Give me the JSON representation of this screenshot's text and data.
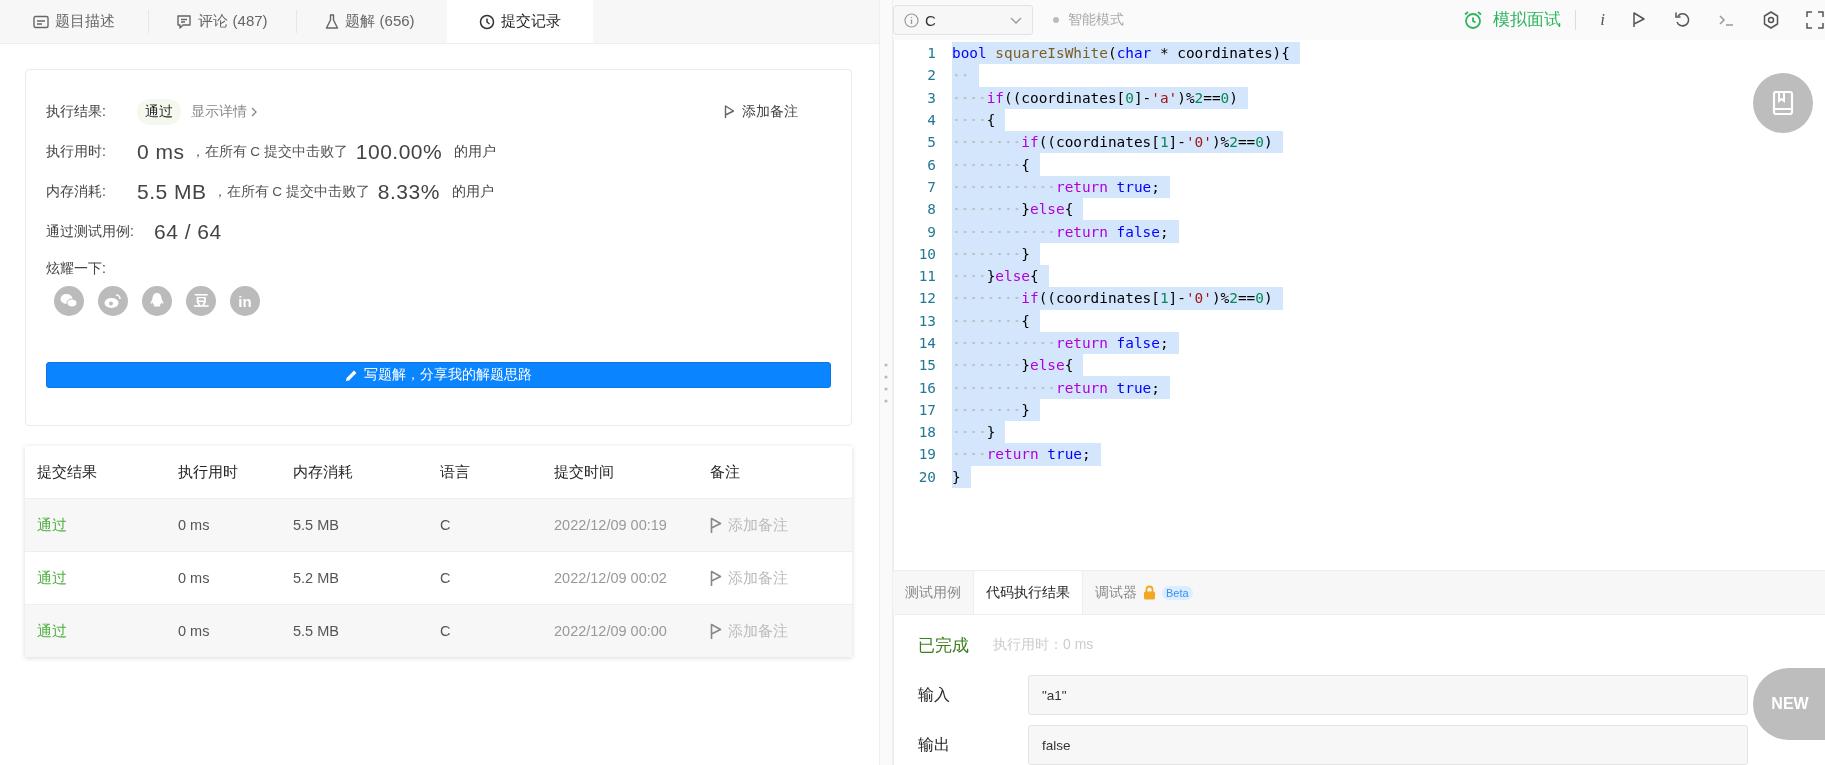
{
  "tabs": [
    {
      "label": "题目描述",
      "selected": false
    },
    {
      "label": "评论 (487)",
      "selected": false
    },
    {
      "label": "题解 (656)",
      "selected": false
    },
    {
      "label": "提交记录",
      "selected": true
    }
  ],
  "result_card": {
    "result_label": "执行结果:",
    "status": "通过",
    "details_link": "显示详情",
    "add_note": "添加备注",
    "stats": [
      {
        "label": "执行用时:",
        "value": "0 ms",
        "middle": "，在所有 C 提交中击败了",
        "percent": "100.00%",
        "suffix": "的用户"
      },
      {
        "label": "内存消耗:",
        "value": "5.5 MB",
        "middle": "，在所有 C 提交中击败了",
        "percent": "8.33%",
        "suffix": "的用户"
      }
    ],
    "tests_label": "通过测试用例:",
    "tests_value": "64 / 64",
    "share_label": "炫耀一下:",
    "share_icons": [
      {
        "kind": "wechat"
      },
      {
        "kind": "weibo"
      },
      {
        "kind": "qq"
      },
      {
        "kind": "douban",
        "text": "豆"
      },
      {
        "kind": "linkedin",
        "text": "in"
      }
    ],
    "write_button": "写题解，分享我的解题思路"
  },
  "submissions": {
    "columns": [
      "提交结果",
      "执行用时",
      "内存消耗",
      "语言",
      "提交时间",
      "备注"
    ],
    "rows": [
      {
        "status": "通过",
        "time": "0 ms",
        "memory": "5.5 MB",
        "language": "C",
        "submitted": "2022/12/09 00:19",
        "note": "添加备注"
      },
      {
        "status": "通过",
        "time": "0 ms",
        "memory": "5.2 MB",
        "language": "C",
        "submitted": "2022/12/09 00:02",
        "note": "添加备注"
      },
      {
        "status": "通过",
        "time": "0 ms",
        "memory": "5.5 MB",
        "language": "C",
        "submitted": "2022/12/09 00:00",
        "note": "添加备注"
      }
    ]
  },
  "editor": {
    "language": "C",
    "mode": "智能模式",
    "interview_button": "模拟面试",
    "info_button": "i",
    "lines": [
      {
        "number": "1",
        "selected": true,
        "tokens": [
          {
            "kind": "type",
            "text": "bool"
          },
          {
            "kind": "func",
            "text": " squareIsWhite"
          },
          {
            "kind": "plain",
            "text": "("
          },
          {
            "kind": "type",
            "text": "char"
          },
          {
            "kind": "plain",
            "text": " * coordinates){"
          }
        ]
      },
      {
        "number": "2",
        "selected": true
      },
      {
        "number": "3",
        "selected": true,
        "tokens": [
          {
            "kind": "control",
            "text": "    if"
          },
          {
            "kind": "plain",
            "text": "((coordinates["
          },
          {
            "kind": "number",
            "text": "0"
          },
          {
            "kind": "plain",
            "text": "]-"
          },
          {
            "kind": "string",
            "text": "'a'"
          },
          {
            "kind": "plain",
            "text": ")%"
          },
          {
            "kind": "number",
            "text": "2"
          },
          {
            "kind": "plain",
            "text": "=="
          },
          {
            "kind": "number",
            "text": "0"
          },
          {
            "kind": "plain",
            "text": ")"
          }
        ]
      },
      {
        "number": "4",
        "selected": true,
        "tokens": [
          {
            "kind": "plain",
            "text": "    {"
          }
        ]
      },
      {
        "number": "5",
        "selected": true,
        "tokens": [
          {
            "kind": "control",
            "text": "        if"
          },
          {
            "kind": "plain",
            "text": "((coordinates["
          },
          {
            "kind": "number",
            "text": "1"
          },
          {
            "kind": "plain",
            "text": "]-"
          },
          {
            "kind": "string",
            "text": "'0'"
          },
          {
            "kind": "plain",
            "text": ")%"
          },
          {
            "kind": "number",
            "text": "2"
          },
          {
            "kind": "plain",
            "text": "=="
          },
          {
            "kind": "number",
            "text": "0"
          },
          {
            "kind": "plain",
            "text": ")"
          }
        ]
      },
      {
        "number": "6",
        "selected": true,
        "tokens": [
          {
            "kind": "plain",
            "text": "        {"
          }
        ]
      },
      {
        "number": "7",
        "selected": true,
        "tokens": [
          {
            "kind": "control",
            "text": "            return"
          },
          {
            "kind": "type",
            "text": " true"
          },
          {
            "kind": "plain",
            "text": ";"
          }
        ]
      },
      {
        "number": "8",
        "selected": true,
        "tokens": [
          {
            "kind": "plain",
            "text": "        }"
          },
          {
            "kind": "control",
            "text": "else"
          },
          {
            "kind": "plain",
            "text": "{"
          }
        ]
      },
      {
        "number": "9",
        "selected": true,
        "tokens": [
          {
            "kind": "control",
            "text": "            return"
          },
          {
            "kind": "type",
            "text": " false"
          },
          {
            "kind": "plain",
            "text": ";"
          }
        ]
      },
      {
        "number": "10",
        "selected": true,
        "tokens": [
          {
            "kind": "plain",
            "text": "        }"
          }
        ]
      },
      {
        "number": "11",
        "selected": true,
        "tokens": [
          {
            "kind": "plain",
            "text": "    }"
          },
          {
            "kind": "control",
            "text": "else"
          },
          {
            "kind": "plain",
            "text": "{"
          }
        ]
      },
      {
        "number": "12",
        "selected": true,
        "tokens": [
          {
            "kind": "control",
            "text": "        if"
          },
          {
            "kind": "plain",
            "text": "((coordinates["
          },
          {
            "kind": "number",
            "text": "1"
          },
          {
            "kind": "plain",
            "text": "]-"
          },
          {
            "kind": "string",
            "text": "'0'"
          },
          {
            "kind": "plain",
            "text": ")%"
          },
          {
            "kind": "number",
            "text": "2"
          },
          {
            "kind": "plain",
            "text": "=="
          },
          {
            "kind": "number",
            "text": "0"
          },
          {
            "kind": "plain",
            "text": ")"
          }
        ]
      },
      {
        "number": "13",
        "selected": true,
        "tokens": [
          {
            "kind": "plain",
            "text": "        {"
          }
        ]
      },
      {
        "number": "14",
        "selected": true,
        "tokens": [
          {
            "kind": "control",
            "text": "            return"
          },
          {
            "kind": "type",
            "text": " false"
          },
          {
            "kind": "plain",
            "text": ";"
          }
        ]
      },
      {
        "number": "15",
        "selected": true,
        "tokens": [
          {
            "kind": "plain",
            "text": "        }"
          },
          {
            "kind": "control",
            "text": "else"
          },
          {
            "kind": "plain",
            "text": "{"
          }
        ]
      },
      {
        "number": "16",
        "selected": true,
        "tokens": [
          {
            "kind": "control",
            "text": "            return"
          },
          {
            "kind": "type",
            "text": " true"
          },
          {
            "kind": "plain",
            "text": ";"
          }
        ]
      },
      {
        "number": "17",
        "selected": true,
        "tokens": [
          {
            "kind": "plain",
            "text": "        }"
          }
        ]
      },
      {
        "number": "18",
        "selected": true,
        "tokens": [
          {
            "kind": "plain",
            "text": "    }"
          }
        ]
      },
      {
        "number": "19",
        "selected": true,
        "tokens": [
          {
            "kind": "control",
            "text": "    return"
          },
          {
            "kind": "type",
            "text": " true"
          },
          {
            "kind": "plain",
            "text": ";"
          }
        ]
      },
      {
        "number": "20",
        "selected": true,
        "tokens": [
          {
            "kind": "plain",
            "text": "}"
          }
        ]
      }
    ]
  },
  "console": {
    "tabs": [
      {
        "label": "测试用例",
        "selected": false
      },
      {
        "label": "代码执行结果",
        "selected": true
      },
      {
        "label": "调试器",
        "selected": false,
        "locked": true,
        "badge": "Beta"
      }
    ],
    "status": "已完成",
    "runtime": "执行用时：0 ms",
    "fields": [
      {
        "label": "输入",
        "value": "\"a1\""
      },
      {
        "label": "输出",
        "value": "false"
      }
    ]
  },
  "float_buttons": [
    {
      "kind": "bookmark"
    },
    {
      "kind": "new",
      "text": "NEW"
    }
  ]
}
